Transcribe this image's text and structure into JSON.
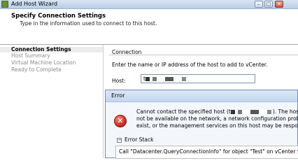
{
  "window": {
    "title": "Add Host Wizard",
    "controls": {
      "minimize": "–",
      "maximize": "□",
      "close": "✕"
    },
    "icon": "vcenter-app-icon"
  },
  "header": {
    "title": "Specify Connection Settings",
    "subtitle": "Type in the information used to connect to this host."
  },
  "sidebar": {
    "items": [
      {
        "label": "Connection Settings",
        "active": true
      },
      {
        "label": "Host Summary",
        "active": false
      },
      {
        "label": "Virtual Machine Location",
        "active": false
      },
      {
        "label": "Ready to Complete",
        "active": false
      }
    ]
  },
  "connection": {
    "section_label": "Connection",
    "description": "Enter the name or IP address of the host to add to vCenter.",
    "host_label": "Host:",
    "host_value": "t"
  },
  "error_dialog": {
    "title": "Error",
    "icon": "error-icon",
    "message_line1_prefix": "Cannot contact the specified host (t",
    "message_line1_suffix": "). The host m",
    "message_line2": "not be available on the network, a network configuration problem m",
    "message_line3": "exist, or the management services on this host may be respondin",
    "stack_toggle_symbol": "−",
    "stack_label": "Error Stack",
    "stack_text": "Call \"Datacenter.QueryConnectionInfo\" for object \"Test\" on vCenter Server \"T"
  }
}
